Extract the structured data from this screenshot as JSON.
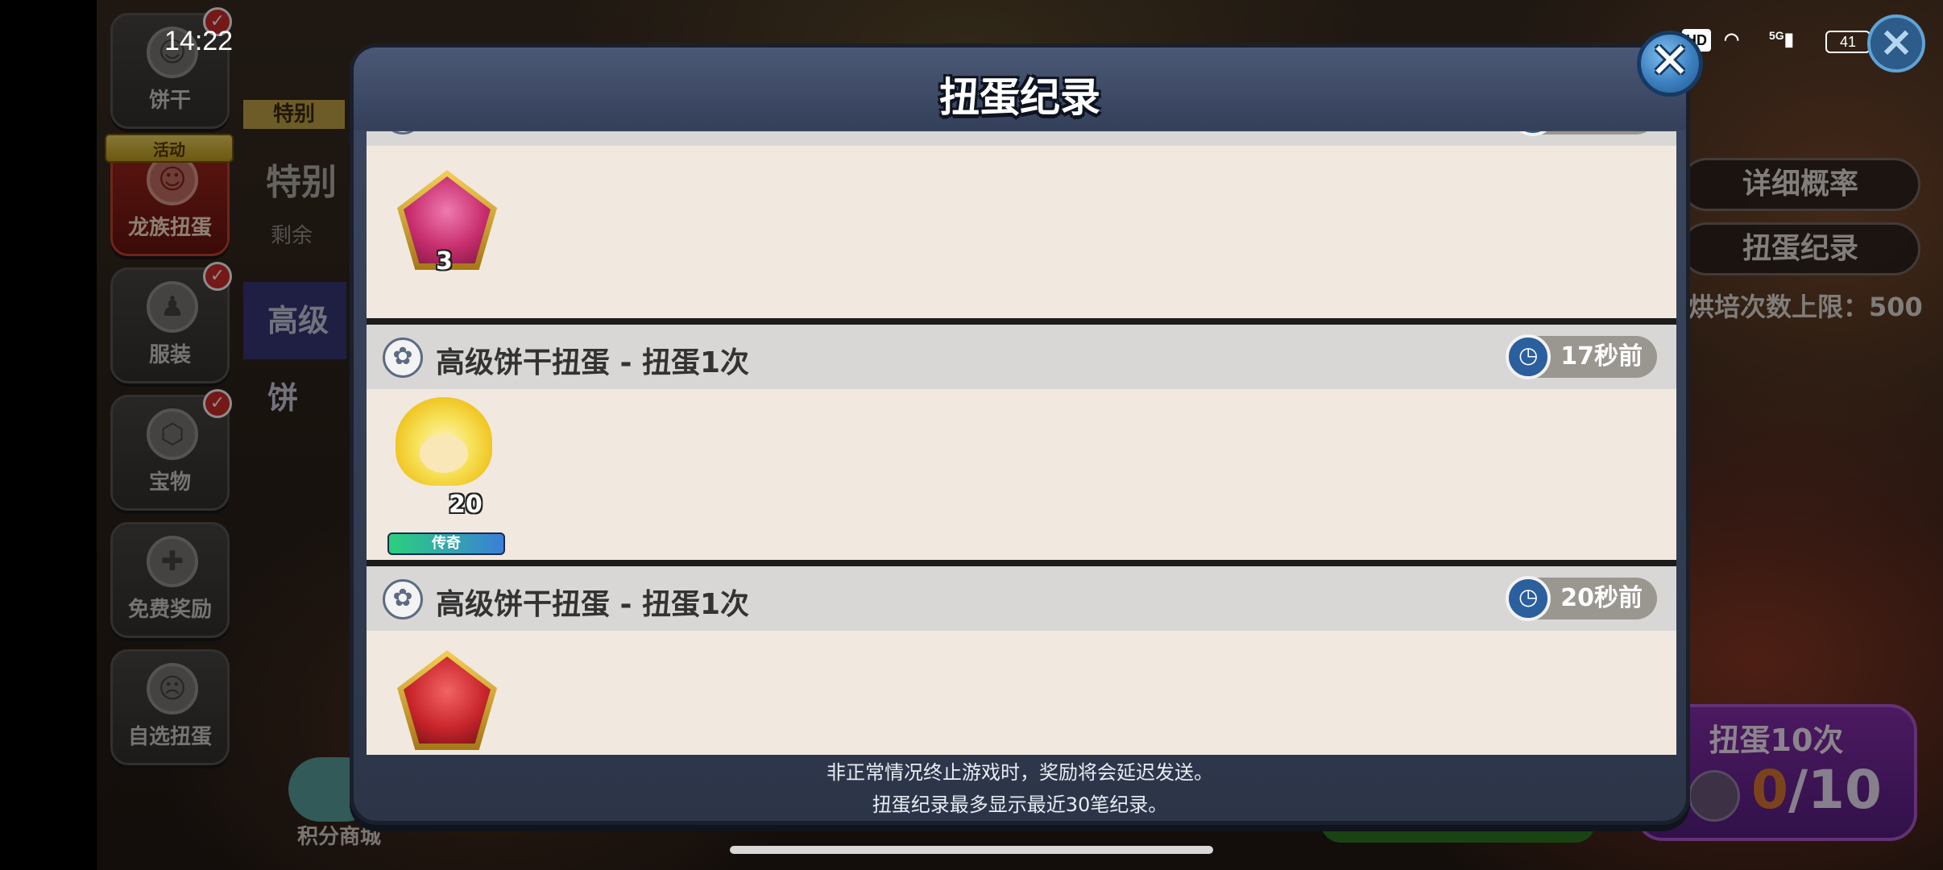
{
  "status_bar": {
    "time": "14:22",
    "hd": "HD",
    "network": "5G",
    "battery": "41"
  },
  "side_menu": [
    {
      "label": "饼干",
      "icon": "cookie-icon",
      "badge": "✓"
    },
    {
      "label": "龙族扭蛋",
      "icon": "dragon-gacha-icon",
      "ribbon": "活动",
      "active": true
    },
    {
      "label": "服装",
      "icon": "costume-icon",
      "badge": "✓"
    },
    {
      "label": "宝物",
      "icon": "treasure-icon",
      "badge": "✓"
    },
    {
      "label": "免费奖励",
      "icon": "gift-icon"
    },
    {
      "label": "自选扭蛋",
      "icon": "pick-gacha-icon"
    }
  ],
  "background": {
    "tab_special": "特别",
    "title_partial": "特别",
    "remaining_partial": "剩余",
    "advanced_partial": "高级饼",
    "shop_label": "积分商城",
    "right_buttons": [
      "详细概率",
      "扭蛋纪录"
    ],
    "bake_limit": "烘培次数上限：500",
    "pull10": {
      "label": "扭蛋10次",
      "count_current": "0",
      "count_total": "/10"
    }
  },
  "modal": {
    "title": "扭蛋纪录",
    "close_label": "✕",
    "entries": [
      {
        "name": "",
        "time": "",
        "item": {
          "type": "soulstone",
          "color": "pink",
          "qty": "3"
        }
      },
      {
        "name": "高级饼干扭蛋 - 扭蛋1次",
        "time": "17秒前",
        "item": {
          "type": "cookie",
          "qty": "20",
          "rarity": "传奇"
        }
      },
      {
        "name": "高级饼干扭蛋 - 扭蛋1次",
        "time": "20秒前",
        "item": {
          "type": "soulstone",
          "color": "red",
          "qty": ""
        }
      }
    ],
    "footer": [
      "非正常情况终止游戏时，奖励将会延迟发送。",
      "扭蛋纪录最多显示最近30笔纪录。"
    ]
  },
  "colors": {
    "modal_bg": "#3c4860",
    "entry_bg": "#f1e9df",
    "entry_header": "#d9d7d5",
    "time_pill": "#9a9690",
    "accent_blue": "#2b5f9e"
  }
}
